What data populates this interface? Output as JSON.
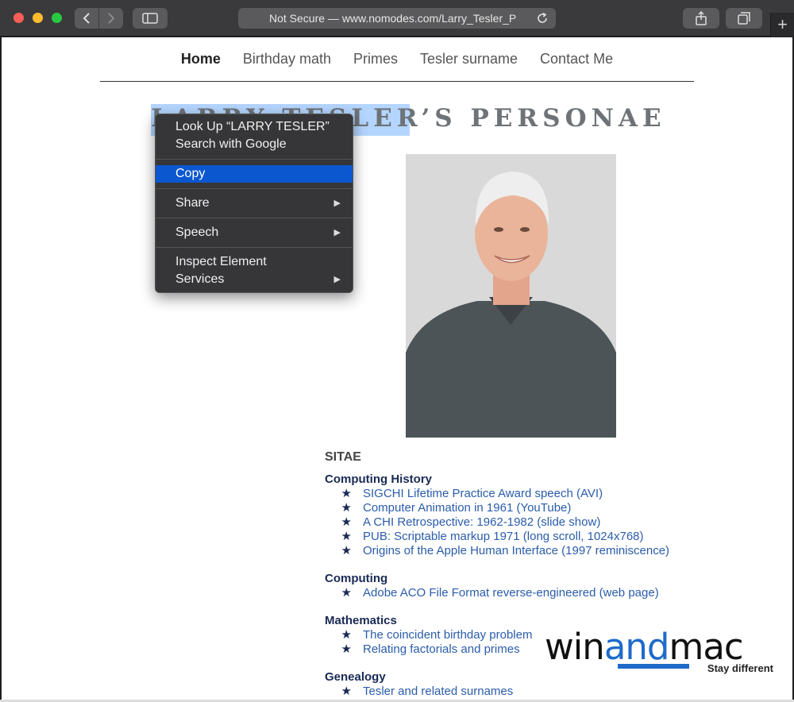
{
  "browser": {
    "url": "Not Secure — www.nomodes.com/Larry_Tesler_P",
    "icons": [
      "chevron-left-icon",
      "chevron-right-icon",
      "sidebar-icon",
      "reload-icon",
      "share-icon",
      "tabs-icon",
      "plus-icon"
    ],
    "new_tab_label": "+"
  },
  "nav": {
    "items": [
      "Home",
      "Birthday math",
      "Primes",
      "Tesler surname",
      "Contact Me"
    ],
    "active": "Home"
  },
  "title": "LARRY TESLER’S PERSONAE",
  "context_menu": {
    "look_up": "Look Up “LARRY TESLER”",
    "search": "Search with Google",
    "copy": "Copy",
    "share": "Share",
    "speech": "Speech",
    "inspect": "Inspect Element",
    "services": "Services",
    "arrow": "▶"
  },
  "content": {
    "heading": "SITAE",
    "star": "★",
    "sections": [
      {
        "title": "Computing History",
        "items": [
          "SIGCHI Lifetime Practice Award speech (AVI)",
          "Computer Animation in 1961 (YouTube)",
          "A CHI Retrospective: 1962-1982 (slide show)",
          "PUB: Scriptable markup 1971 (long scroll, 1024x768)",
          "Origins of the Apple Human Interface (1997 reminiscence)"
        ]
      },
      {
        "title": "Computing",
        "items": [
          "Adobe ACO File Format reverse-engineered (web page)"
        ]
      },
      {
        "title": "Mathematics",
        "items": [
          "The coincident birthday problem",
          "Relating factorials and primes"
        ]
      },
      {
        "title": "Genealogy",
        "items": [
          "Tesler and related surnames"
        ]
      }
    ]
  },
  "watermark": {
    "win": "win",
    "and": "and",
    "mac": "mac",
    "tagline": "Stay different"
  },
  "colors": {
    "selection": "#b4d5fe",
    "menu_highlight": "#0b57d0",
    "link": "#2a5caa"
  }
}
